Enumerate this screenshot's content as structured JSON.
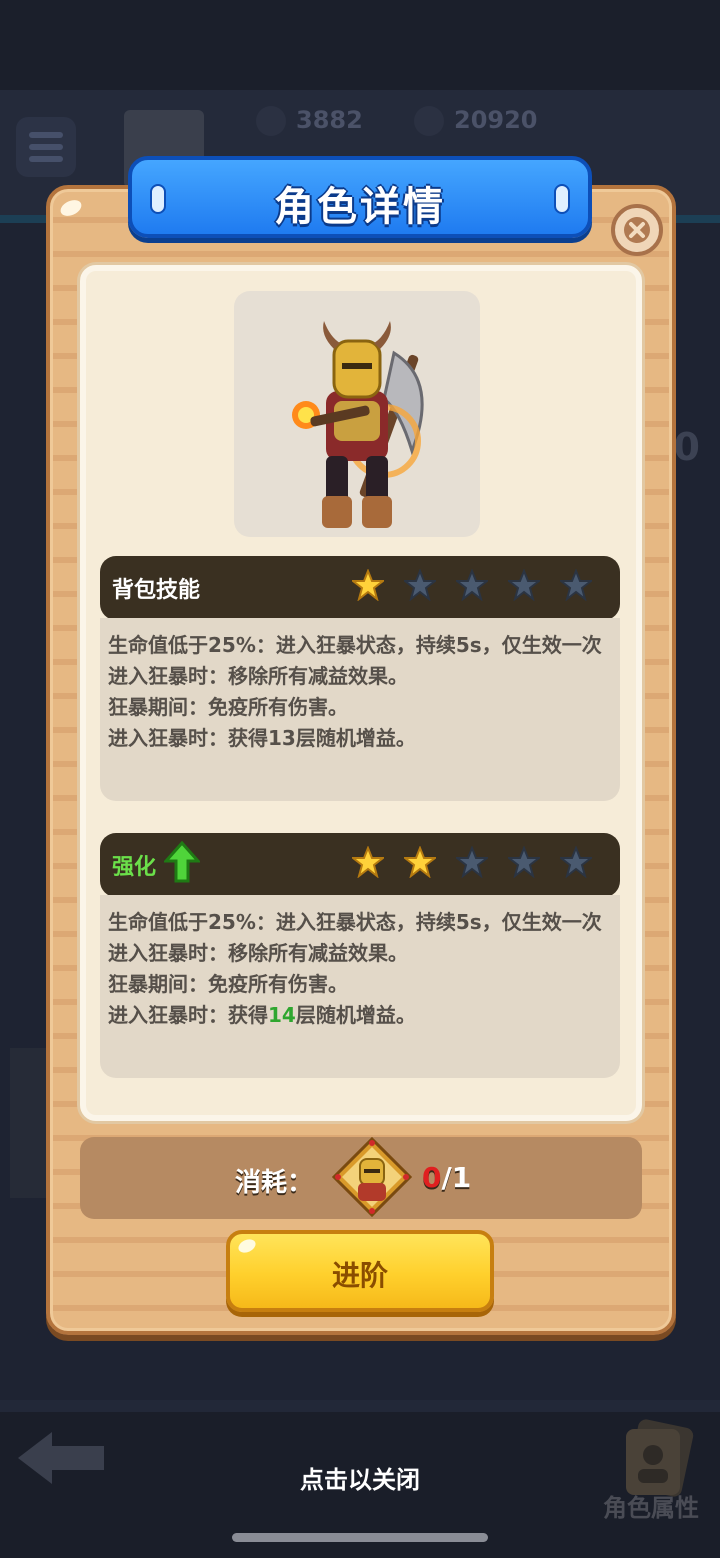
{
  "background": {
    "currency": [
      {
        "icon": "diamond-icon",
        "amount": "3882"
      },
      {
        "icon": "coin-icon",
        "amount": "20920"
      }
    ],
    "side_number": "0",
    "attribute_button_label": "角色属性",
    "close_hint": "点击以关闭"
  },
  "dialog": {
    "title": "角色详情",
    "skill_section": {
      "title": "背包技能",
      "stars_filled": 1,
      "stars_total": 5,
      "lines": [
        "生命值低于25%：进入狂暴状态，持续5s，仅生效一次",
        "进入狂暴时：移除所有减益效果。",
        "狂暴期间：免疫所有伤害。",
        "进入狂暴时：获得13层随机增益。"
      ]
    },
    "upgrade_section": {
      "title": "强化",
      "stars_filled": 2,
      "stars_total": 5,
      "lines": [
        "生命值低于25%：进入狂暴状态，持续5s，仅生效一次",
        "进入狂暴时：移除所有减益效果。",
        "狂暴期间：免疫所有伤害。"
      ],
      "last_line_prefix": "进入狂暴时：获得",
      "last_line_highlight": "14",
      "last_line_suffix": "层随机增益。"
    },
    "cost": {
      "label": "消耗：",
      "have": "0",
      "need": "/1"
    },
    "advance_button": "进阶"
  },
  "colors": {
    "highlight_green": "#2fa62f",
    "cost_missing_red": "#e02020",
    "star_gold": "#ffd23a",
    "star_empty": "#4a5a70"
  }
}
